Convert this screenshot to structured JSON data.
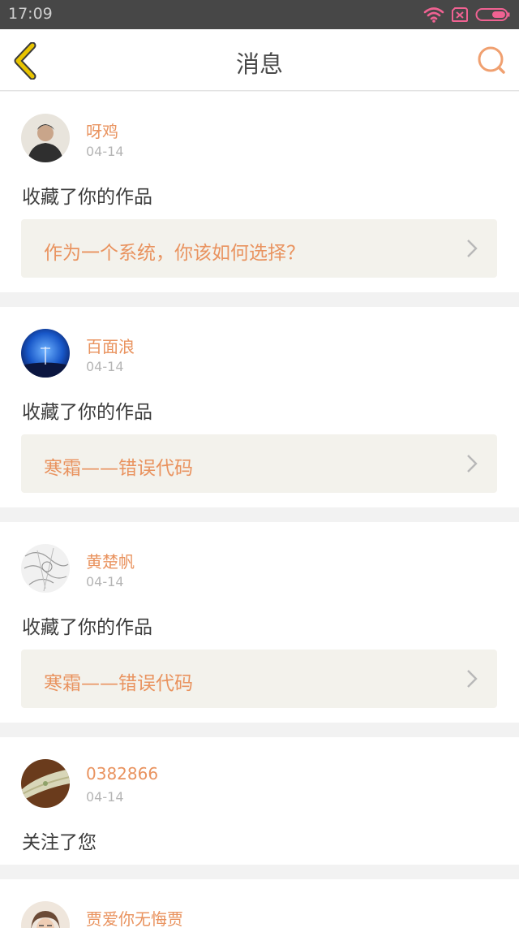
{
  "status_bar": {
    "time": "17:09"
  },
  "header": {
    "title": "消息"
  },
  "messages": [
    {
      "user": "呀鸡",
      "date": "04-14",
      "action": "收藏了你的作品",
      "work": "作为一个系统，你该如何选择？"
    },
    {
      "user": "百面浪",
      "date": "04-14",
      "action": "收藏了你的作品",
      "work": "寒霜——错误代码"
    },
    {
      "user": "黄楚帆",
      "date": "04-14",
      "action": "收藏了你的作品",
      "work": "寒霜——错误代码"
    },
    {
      "user": "0382866",
      "date": "04-14",
      "action": "关注了您"
    },
    {
      "user": "贾爱你无悔贾"
    }
  ],
  "colors": {
    "accent": "#e9935f",
    "back_icon": "#e8c400",
    "status_icon": "#f06292"
  }
}
